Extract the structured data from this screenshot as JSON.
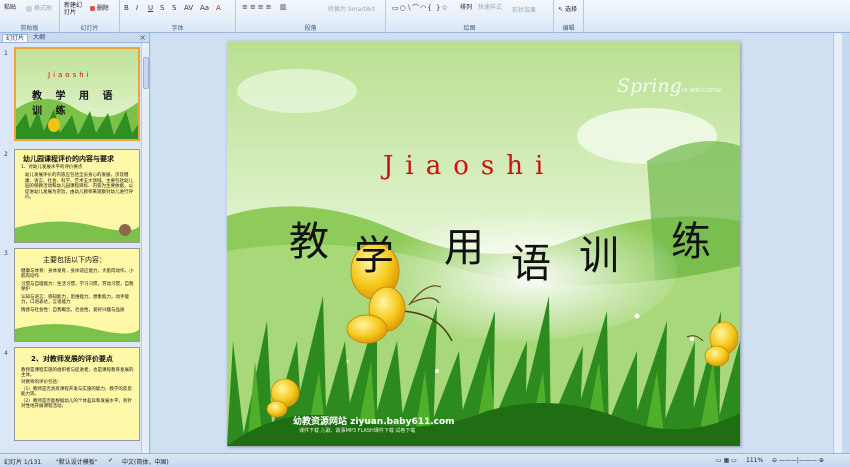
{
  "ribbon": {
    "clipboard": {
      "paste": "粘贴",
      "format_painter": "格式刷",
      "label": "剪贴板"
    },
    "slides": {
      "new_slide": "新建幻灯片",
      "delete": "删除",
      "label": "幻灯片"
    },
    "font": {
      "label": "字体"
    },
    "paragraph": {
      "label": "段落",
      "convert_smartart": "转换为 SmartArt"
    },
    "drawing": {
      "arrange": "排列",
      "quick_styles": "快速样式",
      "shape_effects": "形状效果",
      "label": "绘图"
    },
    "editing": {
      "select": "选择",
      "label": "编辑"
    }
  },
  "panel": {
    "tabs": [
      "幻灯片",
      "大纲"
    ],
    "close": "×",
    "slides": [
      {
        "num": "1",
        "title": "Jiaoshi",
        "subtitle": "教 学 用 语 训 练"
      },
      {
        "num": "2",
        "title": "幼儿园课程评价的内容与要求",
        "lines": [
          "1、对幼儿发展水平的评价要点",
          "幼儿发展评价的内容应包括全员身心的发展，涉及健康、语言、社会、科学、艺术五大领域。主要包括幼儿园的保教活动和幼儿园课程目标、内容为主要依据，以促进幼儿发展为宗旨，由幼儿教师来观察对幼儿进行评价。"
        ]
      },
      {
        "num": "3",
        "title": "主要包括以下内容：",
        "lines": [
          "健康与体育：身体发育，身体适应能力，大肌肉动作，小肌肉动作",
          "习惯与自理能力：生活习惯，学习习惯，劳动习惯，自我保护",
          "认知与语言：感知能力，思维能力，想象能力，动手能力，口语表达，言语能力",
          "情感与社会性：自我概念，社会性，爱好兴趣与品质"
        ]
      },
      {
        "num": "4",
        "title": "2、对教师发展的评价要点",
        "lines": [
          "教师是课程实施的组织者与促进者，也是课程教育发展的主体。",
          "对教师的评价包括：",
          "（1）教师是否具有课程开发与实施的能力、教学的反思能力等。",
          "（2）教师是否能根据幼儿的个体差异和发展水平，有针对性地开展课程活动。"
        ]
      }
    ]
  },
  "slide": {
    "title": "Jiaoshi",
    "subtitle_chars": [
      "教",
      "学",
      "用",
      "语",
      "训",
      "练"
    ],
    "spring": "Spring",
    "spring_tail": "is welcome",
    "watermark": "幼教资源网站 ziyuan.baby611.com",
    "watermark_sub": "课件下载  儿歌、故事MP3  FLASH课件下载  试卷下载"
  },
  "status": {
    "slide_count": "幻灯片 1/131",
    "theme": "\"默认设计模板\"",
    "language": "中文(简体，中国)",
    "zoom": "111%"
  },
  "colors": {
    "title_red": "#cc1111",
    "ribbon_bg": "#dbe7f6",
    "selected_border": "#f3a23a"
  }
}
